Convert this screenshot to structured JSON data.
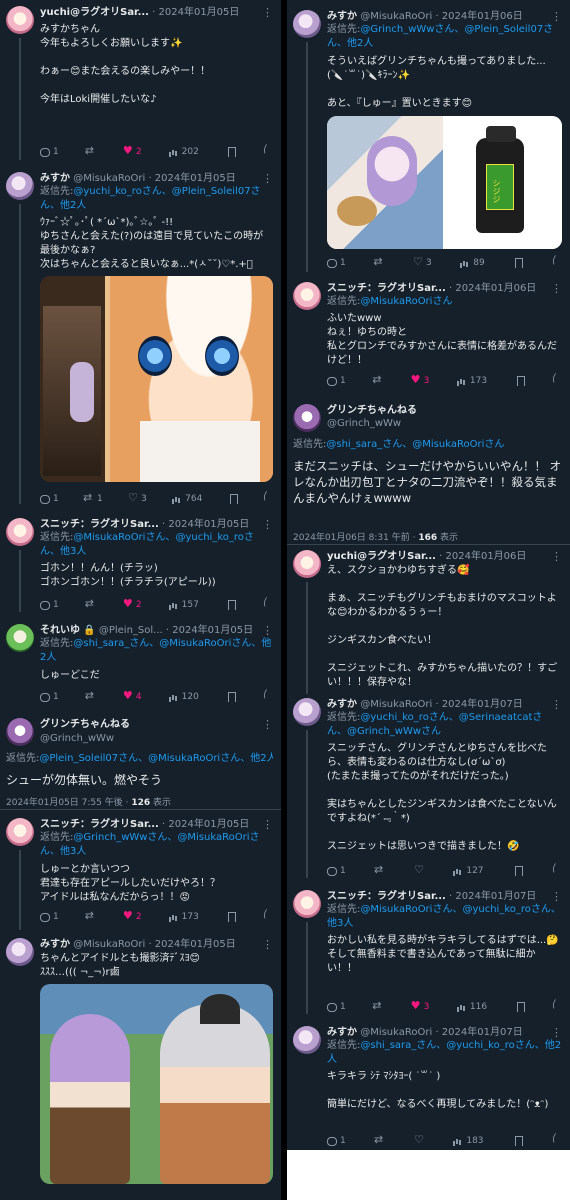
{
  "left": {
    "t1": {
      "name": "yuchi@ラグオリSar...",
      "lock": "",
      "handle": "",
      "date": "· 2024年01月05日",
      "body": "みすかちゃん\n今年もよろしくお願いします✨\n\nわぁー😊また会えるの楽しみやー！！\n\n今年はLoki開催したいな♪",
      "reply": "1",
      "rt": "",
      "like": "2",
      "views": "202"
    },
    "t2": {
      "name": "みすか",
      "handle": "@MisukaRoOri",
      "date": "· 2024年01月05日",
      "rep_prefix": "返信先:",
      "rep_links": "@yuchi_ko_roさん、@Plein_Soleil07さん、他2人",
      "body": "ｳｧｰﾞ☆ﾟ｡･ﾟ( *´ω`*)｡ﾟ☆｡ﾟ -!!\nゆちさんと会えた(?)のは遠目で見ていたこの時が最後かなぁ?\n次はちゃんと会えると良いなぁ...*(ㅅ˘˘)♡*.+ﾟ",
      "reply": "1",
      "rt": "1",
      "like": "3",
      "views": "764"
    },
    "t3": {
      "name": "スニッチ：ラグオリSar...",
      "date": "· 2024年01月05日",
      "rep_prefix": "返信先:",
      "rep_links": "@MisukaRoOriさん、@yuchi_ko_roさん、他3人",
      "body": "ゴホン！！んん！(チラッ)\nゴホンゴホン！！(チラチラ(アピール))",
      "reply": "1",
      "rt": "",
      "like": "2",
      "views": "157"
    },
    "t4": {
      "name": "それいゆ",
      "handle": "@Plein_Sol...",
      "date": "· 2024年01月05日",
      "rep_prefix": "返信先:",
      "rep_links": "@shi_sara_さん、@MisukaRoOriさん、他2人",
      "body": "しゅーどこだ",
      "reply": "1",
      "rt": "",
      "like": "4",
      "views": "120"
    },
    "t5": {
      "name": "グリンチちゃんねる",
      "handle": "@Grinch_wWw",
      "rep_prefix": "返信先:",
      "rep_links": "@Plein_Soleil07さん、@MisukaRoOriさん、他2人",
      "body": "シューが勿体無い。燃やそう",
      "meta_time": "2024年01月05日 7:55 午後 · ",
      "meta_views": "126",
      "meta_suffix": " 表示"
    },
    "t6": {
      "name": "スニッチ：ラグオリSar...",
      "date": "· 2024年01月05日",
      "rep_prefix": "返信先:",
      "rep_links": "@Grinch_wWwさん、@MisukaRoOriさん、他3人",
      "body": "しゅーとか言いつつ\n君達も存在アピールしたいだけやろ！？\nアイドルは私なんだからっ！！😡",
      "reply": "1",
      "rt": "",
      "like": "2",
      "views": "173"
    },
    "t7": {
      "name": "みすか",
      "handle": "@MisukaRoOri",
      "date": "· 2024年01月05日",
      "body": "ちゃんとアイドルとも撮影済ﾃﾞｽﾖ😊\nｽｽｽ…((( ¬_¬)r鹵"
    }
  },
  "right": {
    "r1": {
      "name": "みすか",
      "handle": "@MisukaRoOri",
      "date": "· 2024年01月06日",
      "rep_prefix": "返信先:",
      "rep_links": "@Grinch_wWwさん、@Plein_Soleil07さん、他2人",
      "body": "そういえばグリンチちゃんも撮ってありました...\n(🔪˙꒳​˙)🔪ｷﾗｰﾝ✨\n\nあと、『しゅー』置いときます😊",
      "reply": "1",
      "rt": "",
      "like": "3",
      "views": "89"
    },
    "r2": {
      "name": "スニッチ：ラグオリSar...",
      "date": "· 2024年01月06日",
      "rep_prefix": "返信先:",
      "rep_links": "@MisukaRoOriさん",
      "body": "ふいたwww\nねぇ！ゆちの時と\n私とグロンチでみすかさんに表情に格差があるんだけど！！",
      "reply": "1",
      "rt": "",
      "like": "3",
      "views": "173"
    },
    "r3": {
      "name": "グリンチちゃんねる",
      "handle": "@Grinch_wWw",
      "rep_prefix": "返信先:",
      "rep_links": "@shi_sara_さん、@MisukaRoOriさん",
      "body": "まだスニッチは、シューだけやからいいやん！！\nオレなんか出刃包丁とナタの二刀流やぞ！！殺る気まんまんやんけぇwwww",
      "meta_time": "2024年01月06日 8:31 午前 · ",
      "meta_views": "166",
      "meta_suffix": " 表示"
    },
    "r4": {
      "name": "yuchi@ラグオリSar...",
      "date": "· 2024年01月06日",
      "body": "え、スクショかわゆちすぎる🥰\n\nまぁ、スニッチもグリンチもおまけのマスコットよな😊わかるわかるうぅー！\n\nジンギスカン食べたい！\n\nスニジェットこれ、みすかちゃん描いたの？！すごい！！！保存やな！"
    },
    "r5": {
      "name": "みすか",
      "handle": "@MisukaRoOri",
      "date": "· 2024年01月07日",
      "rep_prefix": "返信先:",
      "rep_links": "@yuchi_ko_roさん、@Serinaeatcatさん、@Grinch_wWwさん",
      "body": "スニッチさん、グリンチさんとゆちさんを比べたら、表情も変わるのは仕方なし(ơ´ω`ơ)\n(たまたま撮ってたのがそれだけだった。)\n\n実はちゃんとしたジンギスカンは食べたことないんですよね(*´﹃｀*)\n\nスニジェットは思いつきで描きました！🤣",
      "reply": "1",
      "rt": "",
      "like": "",
      "views": "127"
    },
    "r6": {
      "name": "スニッチ：ラグオリSar...",
      "date": "· 2024年01月07日",
      "rep_prefix": "返信先:",
      "rep_links": "@MisukaRoOriさん、@yuchi_ko_roさん、他3人",
      "body": "おかしい私を見る時がキラキラしてるはずでは...🤔\nそして無香料まで書き込んであって無駄に細かい！！",
      "reply": "1",
      "rt": "",
      "like": "3",
      "views": "116"
    },
    "r7": {
      "name": "みすか",
      "handle": "@MisukaRoOri",
      "date": "· 2024年01月07日",
      "rep_prefix": "返信先:",
      "rep_links": "@shi_sara_さん、@yuchi_ko_roさん、他2人",
      "body": "キラキラ ｼﾃ ﾏｼﾀﾖｰ( ˙꒳​˙ )\n\n簡単にだけど、なるべく再現してみました！(ᵔᴥᵔ)",
      "reply": "1",
      "rt": "",
      "like": "",
      "views": "183"
    },
    "can_label": "シジジ"
  },
  "colors": {
    "bg": "#15202b",
    "text": "#e7e9ea",
    "muted": "#8b98a5",
    "link": "#1d9bf0",
    "like": "#f91880"
  }
}
